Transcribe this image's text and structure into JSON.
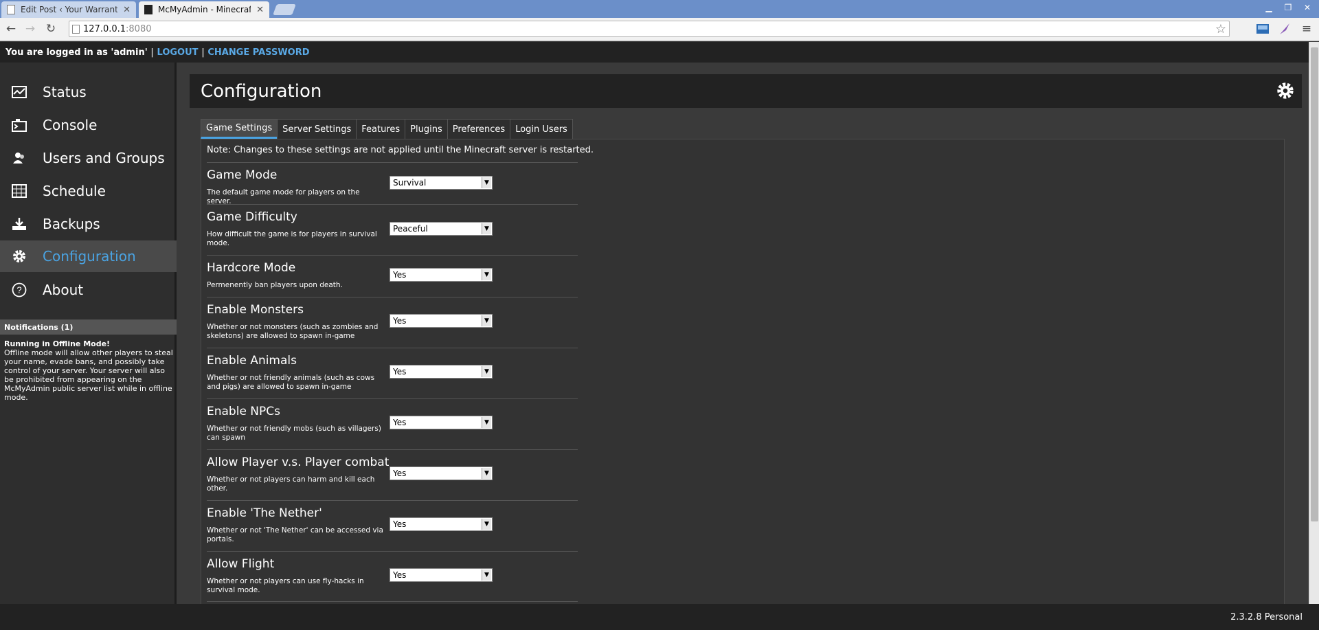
{
  "browser": {
    "tabs": [
      {
        "title": "Edit Post ‹ Your Warranty Is",
        "active": false
      },
      {
        "title": "McMyAdmin - Minecraft Serv",
        "active": true
      }
    ],
    "url_host": "127.0.0.1",
    "url_port": ":8080"
  },
  "topbar": {
    "logged_in_text": "You are logged in as 'admin'",
    "separator": "|",
    "logout_label": "LOGOUT",
    "change_password_label": "CHANGE PASSWORD"
  },
  "sidebar": {
    "items": [
      {
        "label": "Status",
        "icon": "status-icon",
        "active": false
      },
      {
        "label": "Console",
        "icon": "console-icon",
        "active": false
      },
      {
        "label": "Users and Groups",
        "icon": "users-icon",
        "active": false
      },
      {
        "label": "Schedule",
        "icon": "schedule-icon",
        "active": false
      },
      {
        "label": "Backups",
        "icon": "backups-icon",
        "active": false
      },
      {
        "label": "Configuration",
        "icon": "gear-icon",
        "active": true
      },
      {
        "label": "About",
        "icon": "help-icon",
        "active": false
      }
    ],
    "notifications_header": "Notifications (1)",
    "notification_title": "Running in Offline Mode!",
    "notification_text": "Offline mode will allow other players to steal your name, evade bans, and possibly take control of your server. Your server will also be prohibited from appearing on the McMyAdmin public server list while in offline mode."
  },
  "main": {
    "title": "Configuration",
    "tabs": [
      "Game Settings",
      "Server Settings",
      "Features",
      "Plugins",
      "Preferences",
      "Login Users"
    ],
    "active_tab": "Game Settings",
    "note": "Note: Changes to these settings are not applied until the Minecraft server is restarted.",
    "settings": [
      {
        "label": "Game Mode",
        "desc": "The default game mode for players on the server.",
        "value": "Survival"
      },
      {
        "label": "Game Difficulty",
        "desc": "How difficult the game is for players in survival mode.",
        "value": "Peaceful"
      },
      {
        "label": "Hardcore Mode",
        "desc": "Permenently ban players upon death.",
        "value": "Yes"
      },
      {
        "label": "Enable Monsters",
        "desc": "Whether or not monsters (such as zombies and skeletons) are allowed to spawn in-game",
        "value": "Yes"
      },
      {
        "label": "Enable Animals",
        "desc": "Whether or not friendly animals (such as cows and pigs) are allowed to spawn in-game",
        "value": "Yes"
      },
      {
        "label": "Enable NPCs",
        "desc": "Whether or not friendly mobs (such as villagers) can spawn",
        "value": "Yes"
      },
      {
        "label": "Allow Player v.s. Player combat",
        "desc": "Whether or not players can harm and kill each other.",
        "value": "Yes"
      },
      {
        "label": "Enable 'The Nether'",
        "desc": "Whether or not 'The Nether' can be accessed via portals.",
        "value": "Yes"
      },
      {
        "label": "Allow Flight",
        "desc": "Whether or not players can use fly-hacks in survival mode.",
        "value": "Yes"
      }
    ]
  },
  "footer": {
    "version": "2.3.2.8 Personal"
  },
  "colors": {
    "accent": "#4aa3e2",
    "link": "#5aa9e6",
    "background": "#3a3a3a",
    "header": "#222222"
  }
}
